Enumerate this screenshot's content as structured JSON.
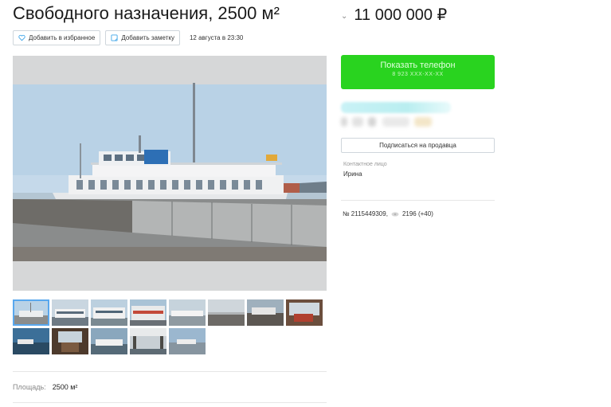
{
  "listing": {
    "title": "Свободного назначения, 2500 м²",
    "price": "11 000 000 ₽",
    "price_toggle_icon": "chevron-down-icon"
  },
  "actions": {
    "favorite_label": "Добавить в избранное",
    "note_label": "Добавить заметку",
    "date": "12 августа в 23:30"
  },
  "gallery": {
    "thumbnail_count": 13,
    "selected_index": 0
  },
  "params": {
    "area_label": "Площадь:",
    "area_value": "2500 м²"
  },
  "seller": {
    "show_phone_label": "Показать телефон",
    "phone_masked": "8 923 XXX-XX-XX",
    "subscribe_label": "Подписаться на продавца",
    "contact_label": "Контактное лицо",
    "contact_name": "Ирина"
  },
  "stats": {
    "ad_number": "№ 2115449309,",
    "views": "2196 (+40)"
  },
  "colors": {
    "accent_green": "#29d31f",
    "selected_outline": "#59a8ee"
  }
}
